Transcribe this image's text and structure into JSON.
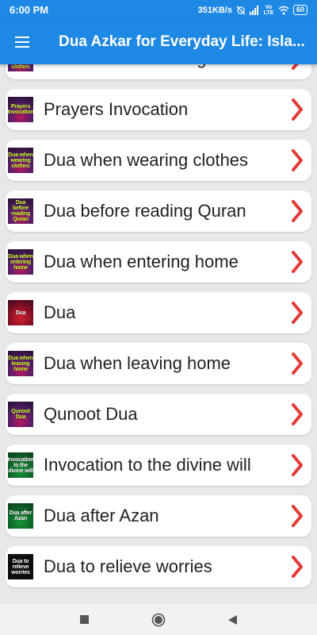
{
  "status_bar": {
    "time": "6:00 PM",
    "network_speed": "351KB/s",
    "lte_label": "Vo LTE",
    "battery": "60"
  },
  "app_bar": {
    "title": "Dua Azkar for Everyday Life: Isla..."
  },
  "items": [
    {
      "label": "Dua before removing clothes",
      "thumb_text": "Dua before removing clothes",
      "thumb_style": ""
    },
    {
      "label": "Prayers Invocation",
      "thumb_text": "Prayers Invocation",
      "thumb_style": ""
    },
    {
      "label": "Dua when wearing clothes",
      "thumb_text": "Dua when wearing clothes",
      "thumb_style": ""
    },
    {
      "label": "Dua before reading Quran",
      "thumb_text": "Dua before reading Quran",
      "thumb_style": ""
    },
    {
      "label": "Dua when entering home",
      "thumb_text": "Dua when entering home",
      "thumb_style": ""
    },
    {
      "label": "Dua",
      "thumb_text": "Dua",
      "thumb_style": "red"
    },
    {
      "label": "Dua when leaving home",
      "thumb_text": "Dua when leaving home",
      "thumb_style": ""
    },
    {
      "label": "Qunoot Dua",
      "thumb_text": "Qunoot Dua",
      "thumb_style": ""
    },
    {
      "label": "Invocation to the divine will",
      "thumb_text": "Invocation to the divine will",
      "thumb_style": "green"
    },
    {
      "label": "Dua after Azan",
      "thumb_text": "Dua after Azan",
      "thumb_style": "green"
    },
    {
      "label": "Dua to relieve worries",
      "thumb_text": "Dua to relieve worries",
      "thumb_style": "dark"
    }
  ],
  "colors": {
    "primary": "#1e88e5",
    "chevron": "#e53935",
    "thumb_text": "#d8ff3c"
  },
  "icons": {
    "menu": "hamburger-menu-icon",
    "chevron": "chevron-right-icon",
    "nav_recents": "square-icon",
    "nav_home": "circle-icon",
    "nav_back": "triangle-left-icon"
  }
}
